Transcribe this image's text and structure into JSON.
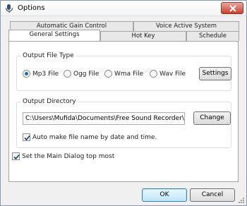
{
  "window": {
    "title": "Options"
  },
  "tabs": {
    "row_back": [
      "Automatic Gain Control",
      "Voice Active System"
    ],
    "row_front": [
      "General Settings",
      "Hot Key",
      "Schedule"
    ]
  },
  "output_file_type": {
    "title": "Output File Type",
    "options": [
      "Mp3 File",
      "Ogg File",
      "Wma File",
      "Wav File"
    ],
    "selected": "Mp3 File",
    "settings_button": "Settings"
  },
  "output_directory": {
    "title": "Output Directory",
    "path": "C:\\Users\\Mufida\\Documents\\Free Sound Recorder\\",
    "change_button": "Change",
    "auto_name_label": "Auto make file name by date and time.",
    "auto_name_checked": true
  },
  "topmost": {
    "label": "Set the Main Dialog top most",
    "checked": true
  },
  "footer": {
    "ok": "OK",
    "cancel": "Cancel"
  }
}
